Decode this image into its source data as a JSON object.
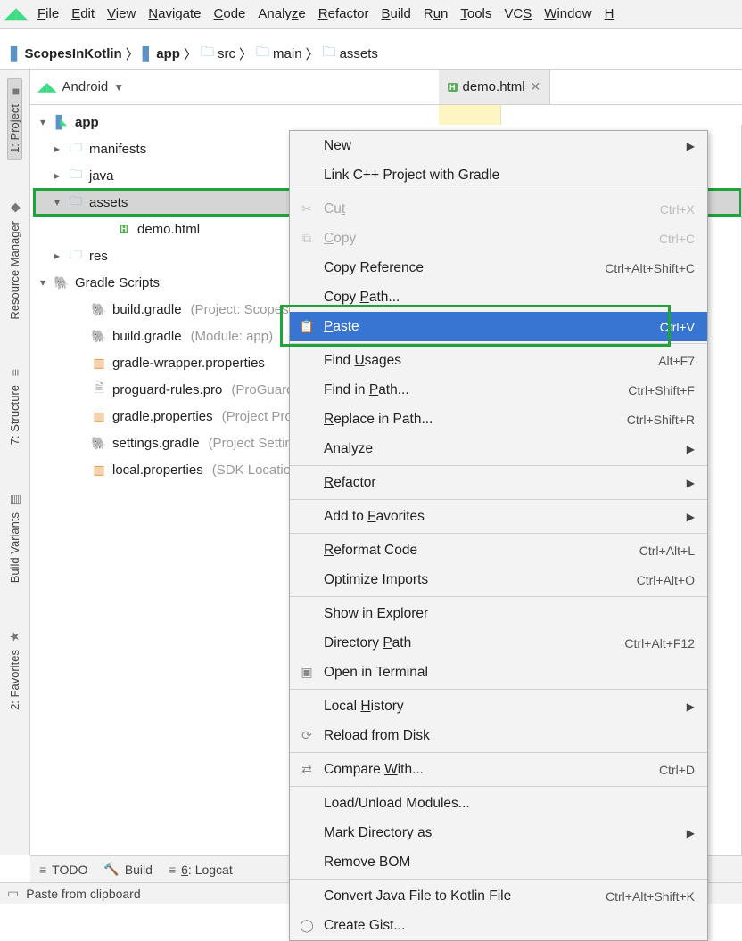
{
  "menubar": {
    "items": [
      {
        "label": "File",
        "u": "F"
      },
      {
        "label": "Edit",
        "u": "E"
      },
      {
        "label": "View",
        "u": "V"
      },
      {
        "label": "Navigate",
        "u": "N"
      },
      {
        "label": "Code",
        "u": "C"
      },
      {
        "label": "Analyze",
        "u": "z"
      },
      {
        "label": "Refactor",
        "u": "R"
      },
      {
        "label": "Build",
        "u": "B"
      },
      {
        "label": "Run",
        "u": "u"
      },
      {
        "label": "Tools",
        "u": "T"
      },
      {
        "label": "VCS",
        "u": "S"
      },
      {
        "label": "Window",
        "u": "W"
      },
      {
        "label": "H",
        "u": "H"
      }
    ]
  },
  "breadcrumbs": [
    {
      "icon": "project",
      "label": "ScopesInKotlin",
      "bold": true
    },
    {
      "icon": "module",
      "label": "app",
      "bold": true
    },
    {
      "icon": "folder",
      "label": "src"
    },
    {
      "icon": "folder",
      "label": "main"
    },
    {
      "icon": "folder",
      "label": "assets"
    }
  ],
  "gutter": [
    {
      "label": "1: Project",
      "icon": "■",
      "active": true
    },
    {
      "label": "Resource Manager",
      "icon": "◆"
    },
    {
      "label": "7: Structure",
      "icon": "≡"
    },
    {
      "label": "Build Variants",
      "icon": "▤"
    },
    {
      "label": "2: Favorites",
      "icon": "★"
    }
  ],
  "projectHeader": {
    "label": "Android"
  },
  "tree": [
    {
      "level": 0,
      "caret": "▾",
      "icon": "module",
      "name": "app",
      "bold": true
    },
    {
      "level": 1,
      "caret": "▸",
      "icon": "folder",
      "name": "manifests"
    },
    {
      "level": 1,
      "caret": "▸",
      "icon": "folder",
      "name": "java"
    },
    {
      "level": 1,
      "caret": "▾",
      "icon": "folder",
      "name": "assets",
      "selected": true,
      "highlight": true
    },
    {
      "level": 3,
      "caret": "",
      "icon": "html",
      "name": "demo.html"
    },
    {
      "level": 1,
      "caret": "▸",
      "icon": "folder",
      "name": "res"
    },
    {
      "level": 0,
      "caret": "▾",
      "icon": "gradle",
      "name": "Gradle Scripts"
    },
    {
      "level": 2,
      "caret": "",
      "icon": "gradle",
      "name": "build.gradle",
      "hint": "(Project: ScopesInKotlin)"
    },
    {
      "level": 2,
      "caret": "",
      "icon": "gradle",
      "name": "build.gradle",
      "hint": "(Module: app)"
    },
    {
      "level": 2,
      "caret": "",
      "icon": "props",
      "name": "gradle-wrapper.properties",
      "hint": ""
    },
    {
      "level": 2,
      "caret": "",
      "icon": "file",
      "name": "proguard-rules.pro",
      "hint": "(ProGuard)"
    },
    {
      "level": 2,
      "caret": "",
      "icon": "props",
      "name": "gradle.properties",
      "hint": "(Project Properties)"
    },
    {
      "level": 2,
      "caret": "",
      "icon": "gradle",
      "name": "settings.gradle",
      "hint": "(Project Settings)"
    },
    {
      "level": 2,
      "caret": "",
      "icon": "props",
      "name": "local.properties",
      "hint": "(SDK Location)"
    }
  ],
  "editor": {
    "tab": {
      "label": "demo.html"
    }
  },
  "contextMenu": [
    {
      "type": "item",
      "label": "New",
      "u": "N",
      "arrow": true
    },
    {
      "type": "item",
      "label": "Link C++ Project with Gradle"
    },
    {
      "type": "sep"
    },
    {
      "type": "item",
      "label": "Cut",
      "u": "t",
      "shortcut": "Ctrl+X",
      "icon": "✂",
      "disabled": true
    },
    {
      "type": "item",
      "label": "Copy",
      "u": "C",
      "shortcut": "Ctrl+C",
      "icon": "⧉",
      "disabled": true
    },
    {
      "type": "item",
      "label": "Copy Reference",
      "shortcut": "Ctrl+Alt+Shift+C"
    },
    {
      "type": "item",
      "label": "Copy Path...",
      "u": "P"
    },
    {
      "type": "item",
      "label": "Paste",
      "u": "P",
      "shortcut": "Ctrl+V",
      "icon": "📋",
      "highlighted": true,
      "boxed": true
    },
    {
      "type": "sep"
    },
    {
      "type": "item",
      "label": "Find Usages",
      "u": "U",
      "shortcut": "Alt+F7"
    },
    {
      "type": "item",
      "label": "Find in Path...",
      "u": "P",
      "shortcut": "Ctrl+Shift+F"
    },
    {
      "type": "item",
      "label": "Replace in Path...",
      "u": "R",
      "shortcut": "Ctrl+Shift+R"
    },
    {
      "type": "item",
      "label": "Analyze",
      "u": "z",
      "arrow": true
    },
    {
      "type": "sep"
    },
    {
      "type": "item",
      "label": "Refactor",
      "u": "R",
      "arrow": true
    },
    {
      "type": "sep"
    },
    {
      "type": "item",
      "label": "Add to Favorites",
      "u": "F",
      "arrow": true
    },
    {
      "type": "sep"
    },
    {
      "type": "item",
      "label": "Reformat Code",
      "u": "R",
      "shortcut": "Ctrl+Alt+L"
    },
    {
      "type": "item",
      "label": "Optimize Imports",
      "u": "z",
      "shortcut": "Ctrl+Alt+O"
    },
    {
      "type": "sep"
    },
    {
      "type": "item",
      "label": "Show in Explorer"
    },
    {
      "type": "item",
      "label": "Directory Path",
      "u": "P",
      "shortcut": "Ctrl+Alt+F12"
    },
    {
      "type": "item",
      "label": "Open in Terminal",
      "icon": "▣"
    },
    {
      "type": "sep"
    },
    {
      "type": "item",
      "label": "Local History",
      "u": "H",
      "arrow": true
    },
    {
      "type": "item",
      "label": "Reload from Disk",
      "icon": "⟳"
    },
    {
      "type": "sep"
    },
    {
      "type": "item",
      "label": "Compare With...",
      "u": "W",
      "shortcut": "Ctrl+D",
      "icon": "⇄"
    },
    {
      "type": "sep"
    },
    {
      "type": "item",
      "label": "Load/Unload Modules..."
    },
    {
      "type": "item",
      "label": "Mark Directory as",
      "arrow": true
    },
    {
      "type": "item",
      "label": "Remove BOM"
    },
    {
      "type": "sep"
    },
    {
      "type": "item",
      "label": "Convert Java File to Kotlin File",
      "shortcut": "Ctrl+Alt+Shift+K"
    },
    {
      "type": "item",
      "label": "Create Gist...",
      "icon": "◯"
    }
  ],
  "bottomTools": [
    {
      "icon": "≡",
      "label": "TODO"
    },
    {
      "icon": "🔨",
      "label": "Build"
    },
    {
      "icon": "≡",
      "label": "6: Logcat",
      "u": "6"
    }
  ],
  "statusbar": {
    "text": "Paste from clipboard"
  }
}
